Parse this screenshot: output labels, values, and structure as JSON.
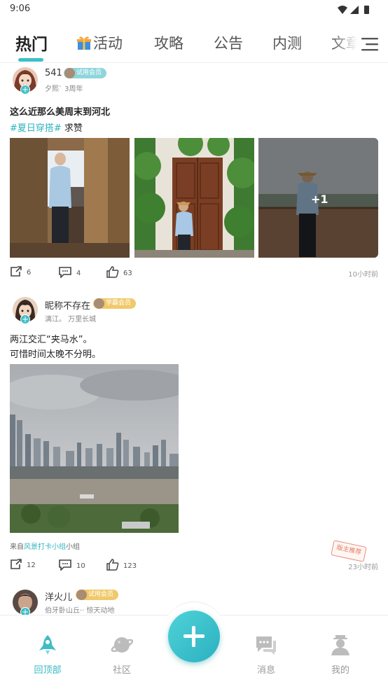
{
  "status_bar": {
    "time": "9:06"
  },
  "tabs": [
    {
      "label": "热门",
      "active": true
    },
    {
      "label": "活动",
      "icon": "gift-icon"
    },
    {
      "label": "攻略"
    },
    {
      "label": "公告"
    },
    {
      "label": "内测"
    },
    {
      "label": "文章"
    }
  ],
  "posts": [
    {
      "username": "541",
      "badge": "试用会员",
      "subtitle": "夕熙`    3周年",
      "title": "这么近那么美周末到河北",
      "tag": "#夏日穿搭#",
      "tag_suffix": " 求赞",
      "more_images": "+1",
      "shares": "6",
      "comments": "4",
      "likes": "63",
      "time": "10小时前"
    },
    {
      "username": "昵称不存在",
      "badge": "学霸会员",
      "subtitle": "漓江。  万里长城",
      "text_line1": "两江交汇“夹马水”。",
      "text_line2": "可惜时间太晚不分明。",
      "from_prefix": "来自",
      "from_link": "风景打卡小组",
      "from_suffix": "小组",
      "stamp": "版主推荐",
      "shares": "12",
      "comments": "10",
      "likes": "123",
      "time": "23小时前"
    },
    {
      "username": "洋火儿",
      "badge": "试用会员",
      "subtitle": "伯牙卧山丘··  惊天动地"
    }
  ],
  "bottom_nav": [
    {
      "label": "回顶部",
      "icon": "rocket-icon",
      "active": true
    },
    {
      "label": "社区",
      "icon": "planet-icon"
    },
    {
      "label": "消息",
      "icon": "chat-icon"
    },
    {
      "label": "我的",
      "icon": "profile-icon"
    }
  ],
  "colors": {
    "accent": "#3dbfc7",
    "tag": "#2fb3bd"
  }
}
